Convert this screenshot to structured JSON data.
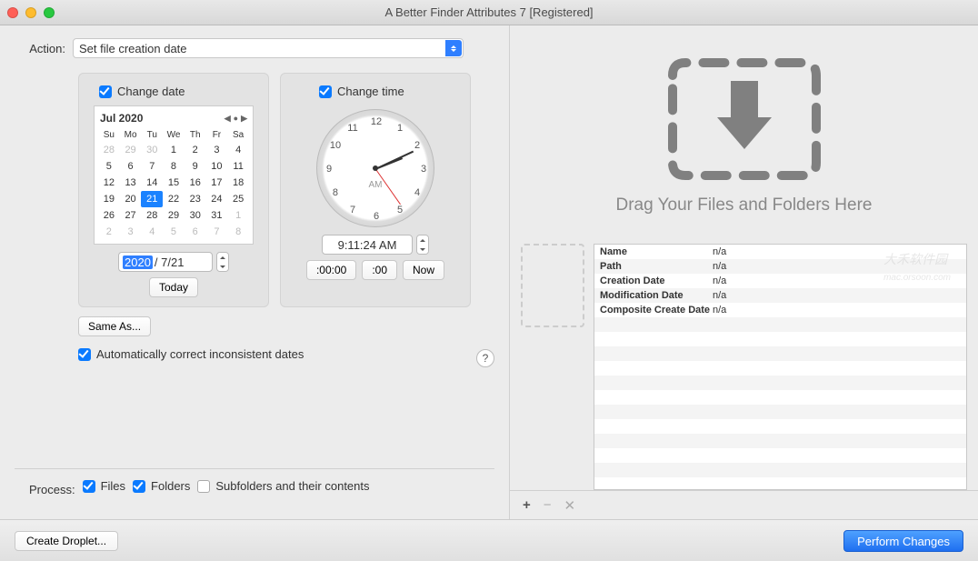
{
  "window": {
    "title": "A Better Finder Attributes 7 [Registered]"
  },
  "action": {
    "label": "Action:",
    "selected": "Set file creation date"
  },
  "changeDate": {
    "checkbox_label": "Change date",
    "cal_month": "Jul 2020",
    "weekdays": [
      "Su",
      "Mo",
      "Tu",
      "We",
      "Th",
      "Fr",
      "Sa"
    ],
    "days": [
      {
        "n": 28,
        "out": true
      },
      {
        "n": 29,
        "out": true
      },
      {
        "n": 30,
        "out": true
      },
      {
        "n": 1
      },
      {
        "n": 2
      },
      {
        "n": 3
      },
      {
        "n": 4
      },
      {
        "n": 5
      },
      {
        "n": 6
      },
      {
        "n": 7
      },
      {
        "n": 8
      },
      {
        "n": 9
      },
      {
        "n": 10
      },
      {
        "n": 11
      },
      {
        "n": 12
      },
      {
        "n": 13
      },
      {
        "n": 14
      },
      {
        "n": 15
      },
      {
        "n": 16
      },
      {
        "n": 17
      },
      {
        "n": 18
      },
      {
        "n": 19
      },
      {
        "n": 20
      },
      {
        "n": 21,
        "sel": true
      },
      {
        "n": 22
      },
      {
        "n": 23
      },
      {
        "n": 24
      },
      {
        "n": 25
      },
      {
        "n": 26
      },
      {
        "n": 27
      },
      {
        "n": 28
      },
      {
        "n": 29
      },
      {
        "n": 30
      },
      {
        "n": 31
      },
      {
        "n": 1,
        "out": true
      },
      {
        "n": 2,
        "out": true
      },
      {
        "n": 3,
        "out": true
      },
      {
        "n": 4,
        "out": true
      },
      {
        "n": 5,
        "out": true
      },
      {
        "n": 6,
        "out": true
      },
      {
        "n": 7,
        "out": true
      },
      {
        "n": 8,
        "out": true
      }
    ],
    "year": "2020",
    "date_suffix": "/ 7/21",
    "today_btn": "Today"
  },
  "changeTime": {
    "checkbox_label": "Change time",
    "ampm": "AM",
    "time_value": "9:11:24 AM",
    "btn_zero_time": ":00:00",
    "btn_zero_sec": ":00",
    "btn_now": "Now"
  },
  "sameAs": {
    "label": "Same As..."
  },
  "autoCorrect": {
    "label": "Automatically correct inconsistent dates"
  },
  "process": {
    "label": "Process:",
    "files": "Files",
    "folders": "Folders",
    "subfolders": "Subfolders and their contents"
  },
  "drop": {
    "text": "Drag Your Files and Folders Here"
  },
  "info": {
    "rows": [
      {
        "k": "Name",
        "v": "n/a"
      },
      {
        "k": "Path",
        "v": "n/a"
      },
      {
        "k": "Creation Date",
        "v": "n/a"
      },
      {
        "k": "Modification Date",
        "v": "n/a"
      },
      {
        "k": "Composite Create Date",
        "v": "n/a"
      }
    ]
  },
  "footer": {
    "create_droplet": "Create Droplet...",
    "perform": "Perform Changes"
  },
  "clock_numbers": [
    "12",
    "1",
    "2",
    "3",
    "4",
    "5",
    "6",
    "7",
    "8",
    "9",
    "10",
    "11"
  ]
}
